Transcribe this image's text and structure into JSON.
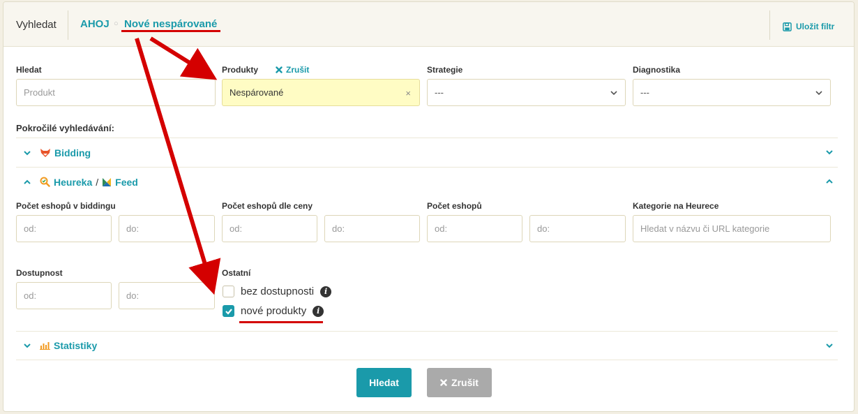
{
  "topbar": {
    "search_label": "Vyhledat",
    "crumbs": [
      "AHOJ",
      "Nové nespárované"
    ],
    "separator": "○",
    "save_filter": "Uložit filtr"
  },
  "filters": {
    "hledat": {
      "label": "Hledat",
      "placeholder": "Produkt"
    },
    "produkty": {
      "label": "Produkty",
      "clear_label": "Zrušit",
      "value": "Nespárované",
      "clear_x": "×"
    },
    "strategie": {
      "label": "Strategie",
      "value": "---"
    },
    "diagnostika": {
      "label": "Diagnostika",
      "value": "---"
    }
  },
  "advanced_label": "Pokročilé vyhledávání:",
  "sections": {
    "bidding": "Bidding",
    "heureka": "Heureka",
    "heureka_sep": "/",
    "feed": "Feed",
    "statistiky": "Statistiky"
  },
  "heureka_fields": {
    "pocet_bidding": {
      "label": "Počet eshopů v biddingu",
      "from": "od:",
      "to": "do:"
    },
    "pocet_ceny": {
      "label": "Počet eshopů dle ceny",
      "from": "od:",
      "to": "do:"
    },
    "pocet_eshopu": {
      "label": "Počet eshopů",
      "from": "od:",
      "to": "do:"
    },
    "kategorie": {
      "label": "Kategorie na Heurece",
      "placeholder": "Hledat v názvu či URL kategorie"
    },
    "dostupnost": {
      "label": "Dostupnost",
      "from": "od:",
      "to": "do:"
    },
    "ostatni": {
      "label": "Ostatní",
      "options": [
        {
          "label": "bez dostupnosti",
          "checked": false
        },
        {
          "label": "nové produkty",
          "checked": true
        }
      ]
    }
  },
  "buttons": {
    "search": "Hledat",
    "cancel": "Zrušit"
  },
  "colors": {
    "accent": "#1a9aaa",
    "annotation": "#d40000"
  }
}
